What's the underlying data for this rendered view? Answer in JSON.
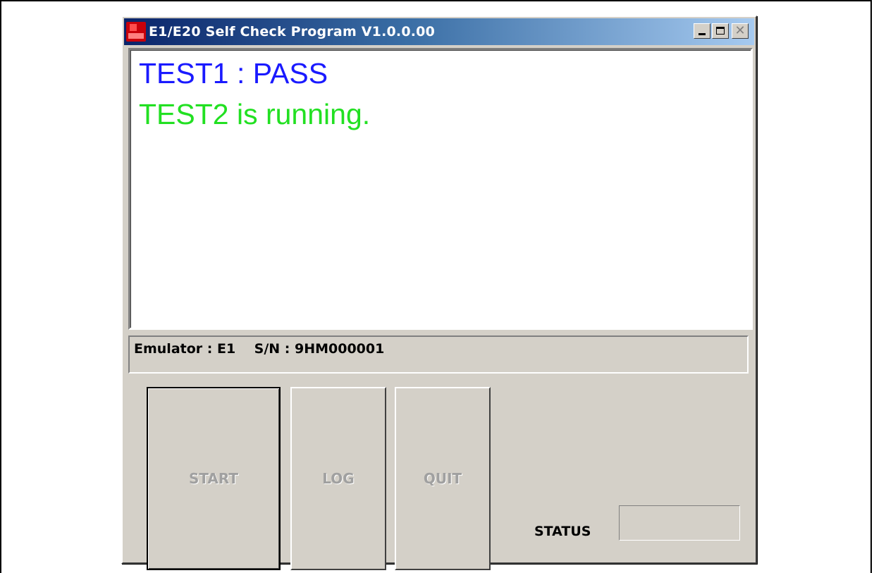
{
  "window": {
    "title": "E1/E20 Self Check Program V1.0.0.00",
    "icon": "app-icon"
  },
  "log": {
    "lines": [
      {
        "text": "TEST1 : PASS",
        "color": "#1a1aff"
      },
      {
        "text": "TEST2 is running.",
        "color": "#22e022"
      }
    ]
  },
  "info": {
    "text": "Emulator : E1    S/N : 9HM000001"
  },
  "buttons": {
    "start": "START",
    "log": "LOG",
    "quit": "QUIT"
  },
  "status": {
    "label": "STATUS",
    "value": ""
  }
}
